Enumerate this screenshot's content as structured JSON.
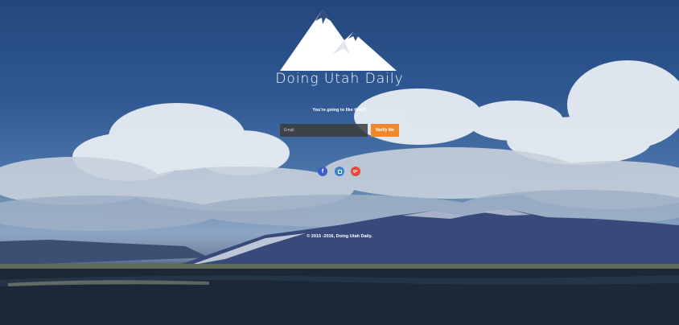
{
  "brand": {
    "name": "Doing Utah Daily"
  },
  "tagline": "You're going to like this!!!",
  "signup": {
    "email_placeholder": "Email",
    "notify_label": "Notify Me"
  },
  "social": {
    "facebook": "f",
    "google_plus": "g+"
  },
  "footer": {
    "copyright": "© 2015 -2016, Doing Utah Daily."
  },
  "colors": {
    "accent": "#f0882a",
    "facebook": "#3b5ec6",
    "instagram": "#3a84c8",
    "google_plus": "#e24a3a"
  },
  "icons": [
    "mountain-logo-icon",
    "facebook-icon",
    "instagram-icon",
    "google-plus-icon"
  ]
}
